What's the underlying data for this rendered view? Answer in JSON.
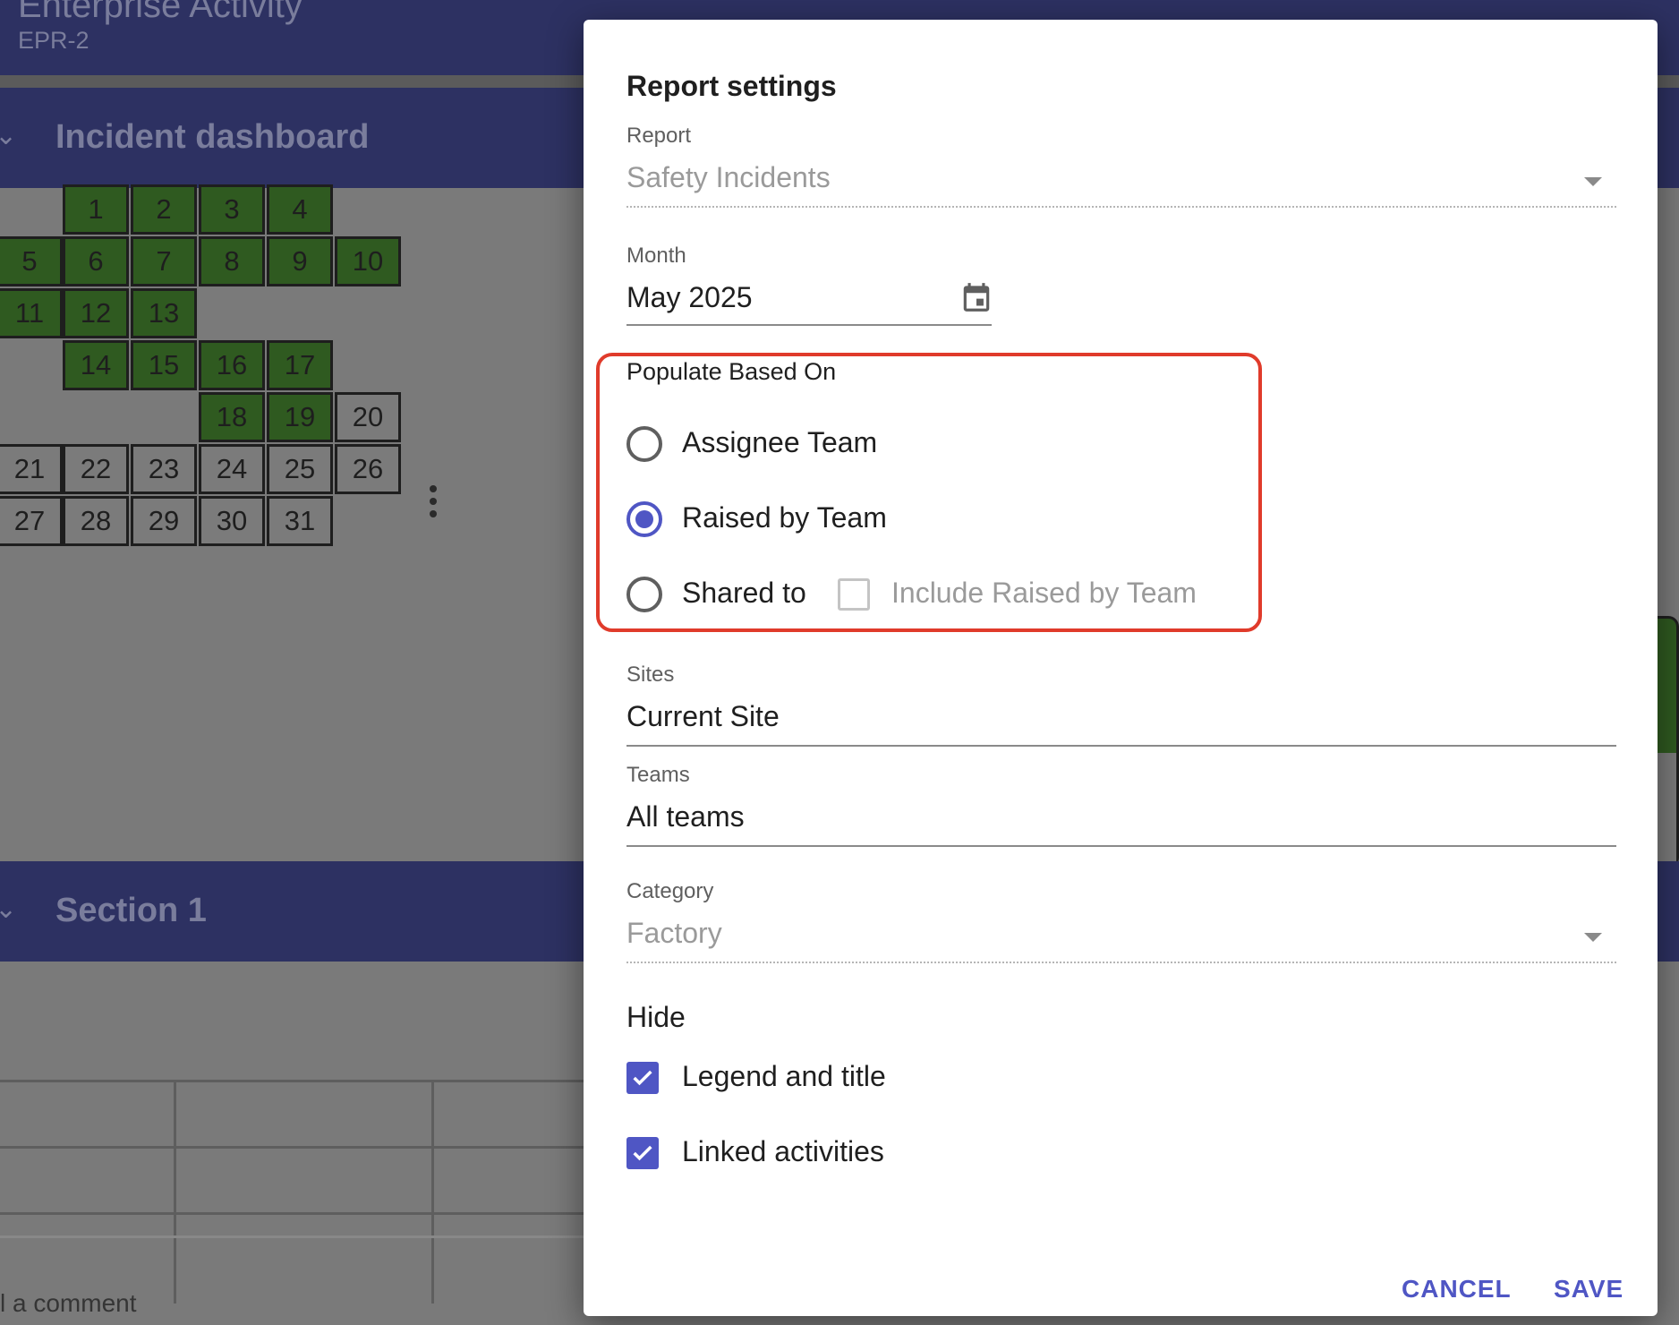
{
  "app": {
    "title": "Enterprise Activity",
    "subtitle": "EPR-2"
  },
  "sections": [
    {
      "label": "Incident dashboard"
    },
    {
      "label": "Section 1"
    }
  ],
  "calendar": {
    "days": [
      "1",
      "2",
      "3",
      "4",
      "5",
      "6",
      "7",
      "8",
      "9",
      "10",
      "11",
      "12",
      "13",
      "14",
      "15",
      "16",
      "17",
      "18",
      "19",
      "20",
      "21",
      "22",
      "23",
      "24",
      "25",
      "26",
      "27",
      "28",
      "29",
      "30",
      "31"
    ],
    "colors": {
      "incident": "#2f5a20",
      "none": "#7b7b7b"
    }
  },
  "comment_hint": "l a comment",
  "dialog": {
    "title": "Report settings",
    "report": {
      "label": "Report",
      "value": "Safety Incidents"
    },
    "month": {
      "label": "Month",
      "value": "May 2025"
    },
    "populate": {
      "label": "Populate Based On",
      "options": [
        "Assignee Team",
        "Raised by Team",
        "Shared to"
      ],
      "selected": "Raised by Team",
      "include_label": "Include Raised by Team"
    },
    "sites": {
      "label": "Sites",
      "value": "Current Site"
    },
    "teams": {
      "label": "Teams",
      "value": "All teams"
    },
    "category": {
      "label": "Category",
      "value": "Factory"
    },
    "hide": {
      "title": "Hide",
      "options": [
        "Legend and title",
        "Linked activities"
      ]
    },
    "actions": {
      "cancel": "CANCEL",
      "save": "SAVE"
    },
    "accent": "#4f56c4",
    "highlight": "#e03b2b"
  }
}
